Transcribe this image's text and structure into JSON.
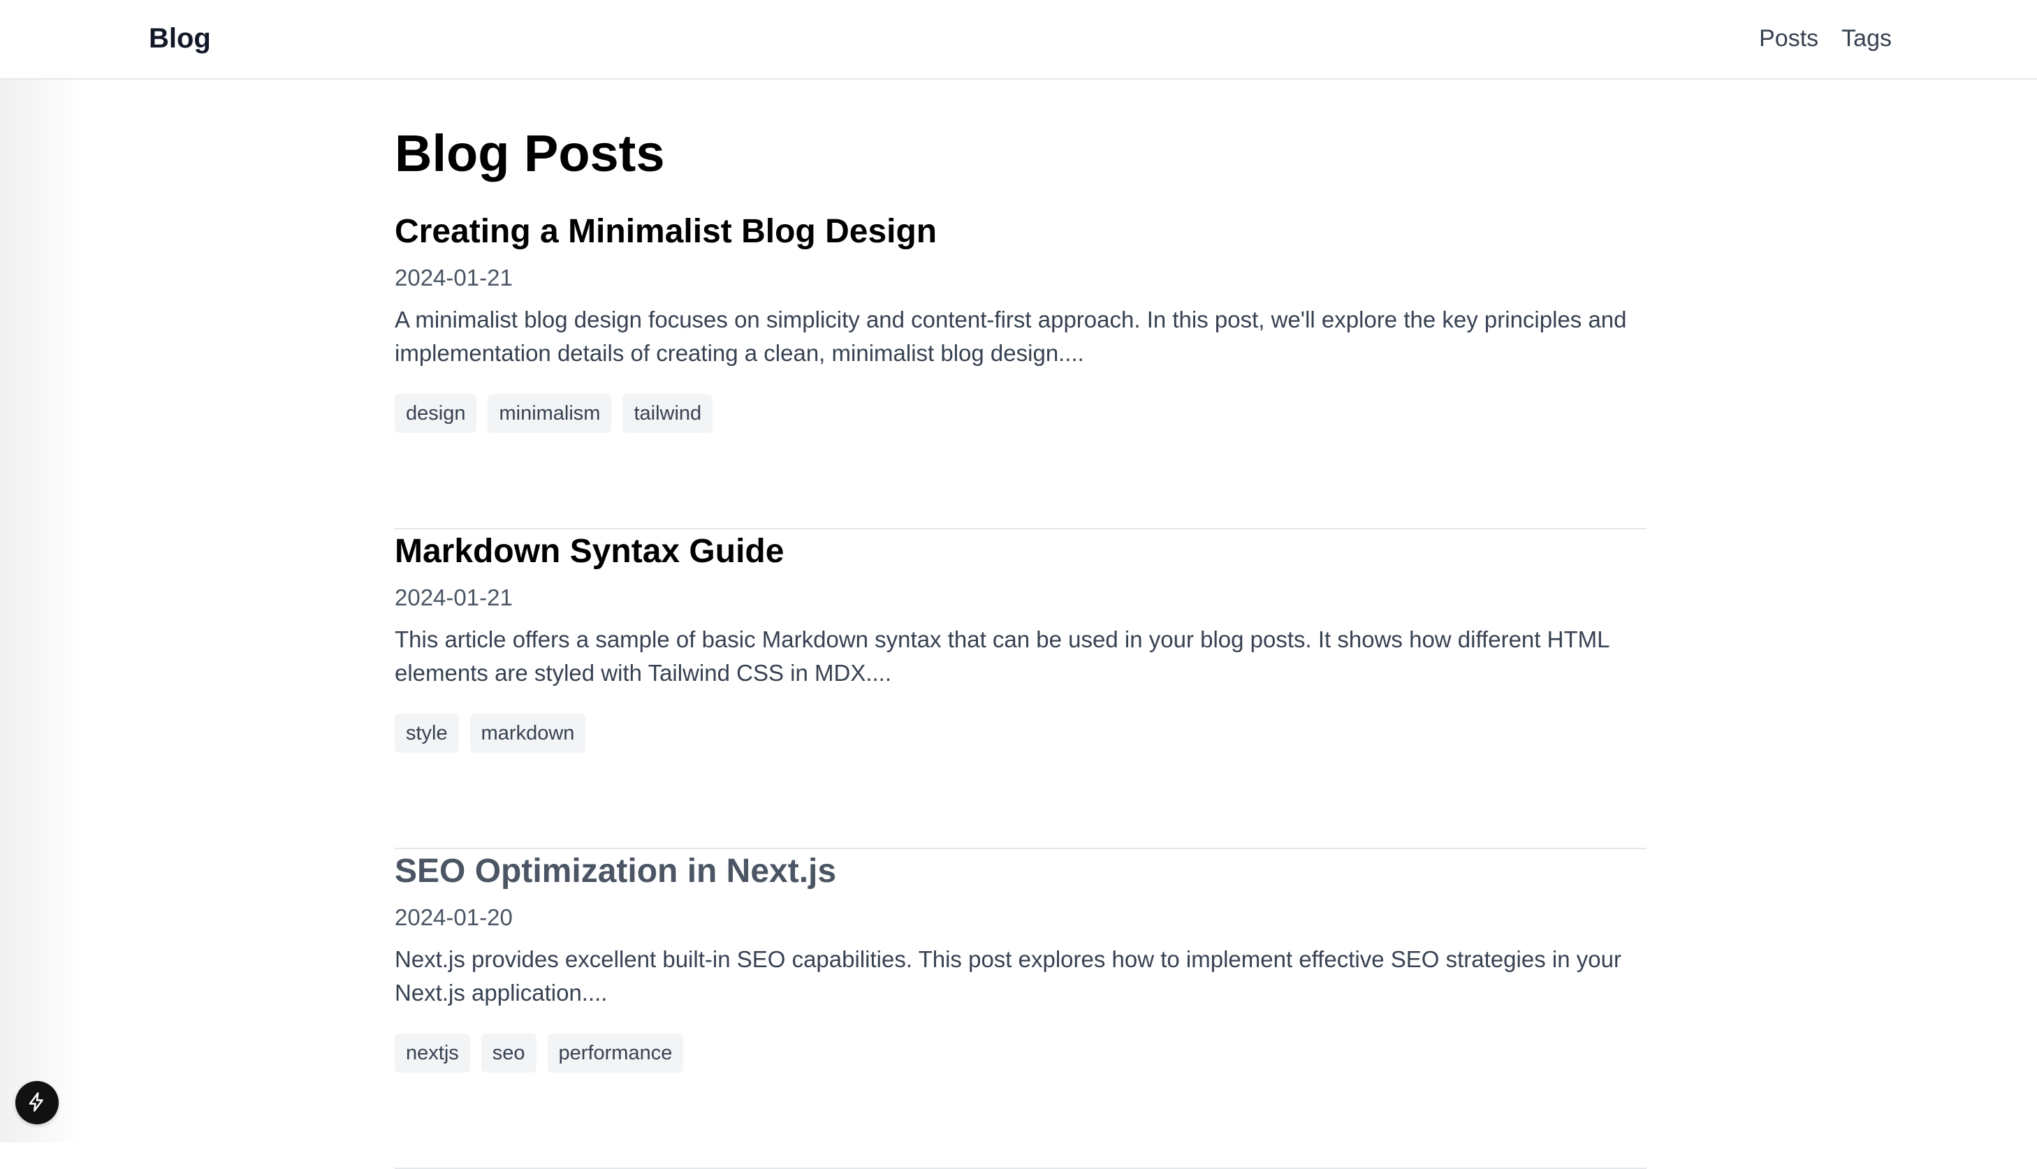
{
  "header": {
    "logo": "Blog",
    "nav": [
      {
        "label": "Posts"
      },
      {
        "label": "Tags"
      }
    ]
  },
  "main": {
    "title": "Blog Posts",
    "posts": [
      {
        "title": "Creating a Minimalist Blog Design",
        "date": "2024-01-21",
        "excerpt": "A minimalist blog design focuses on simplicity and content-first approach. In this post, we'll explore the key principles and implementation details of creating a clean, minimalist blog design....",
        "tags": [
          "design",
          "minimalism",
          "tailwind"
        ]
      },
      {
        "title": "Markdown Syntax Guide",
        "date": "2024-01-21",
        "excerpt": "This article offers a sample of basic Markdown syntax that can be used in your blog posts. It shows how different HTML elements are styled with Tailwind CSS in MDX....",
        "tags": [
          "style",
          "markdown"
        ]
      },
      {
        "title": "SEO Optimization in Next.js",
        "date": "2024-01-20",
        "excerpt": "Next.js provides excellent built-in SEO capabilities. This post explores how to implement effective SEO strategies in your Next.js application....",
        "tags": [
          "nextjs",
          "seo",
          "performance"
        ]
      }
    ]
  },
  "icons": {
    "fab": "lightning-bolt-icon"
  },
  "colors": {
    "title": "#000000",
    "body_text": "#374151",
    "muted_text": "#4b5563",
    "tag_bg": "#f3f4f6",
    "divider": "#e5e7eb",
    "hover_title": "#4b5563"
  }
}
